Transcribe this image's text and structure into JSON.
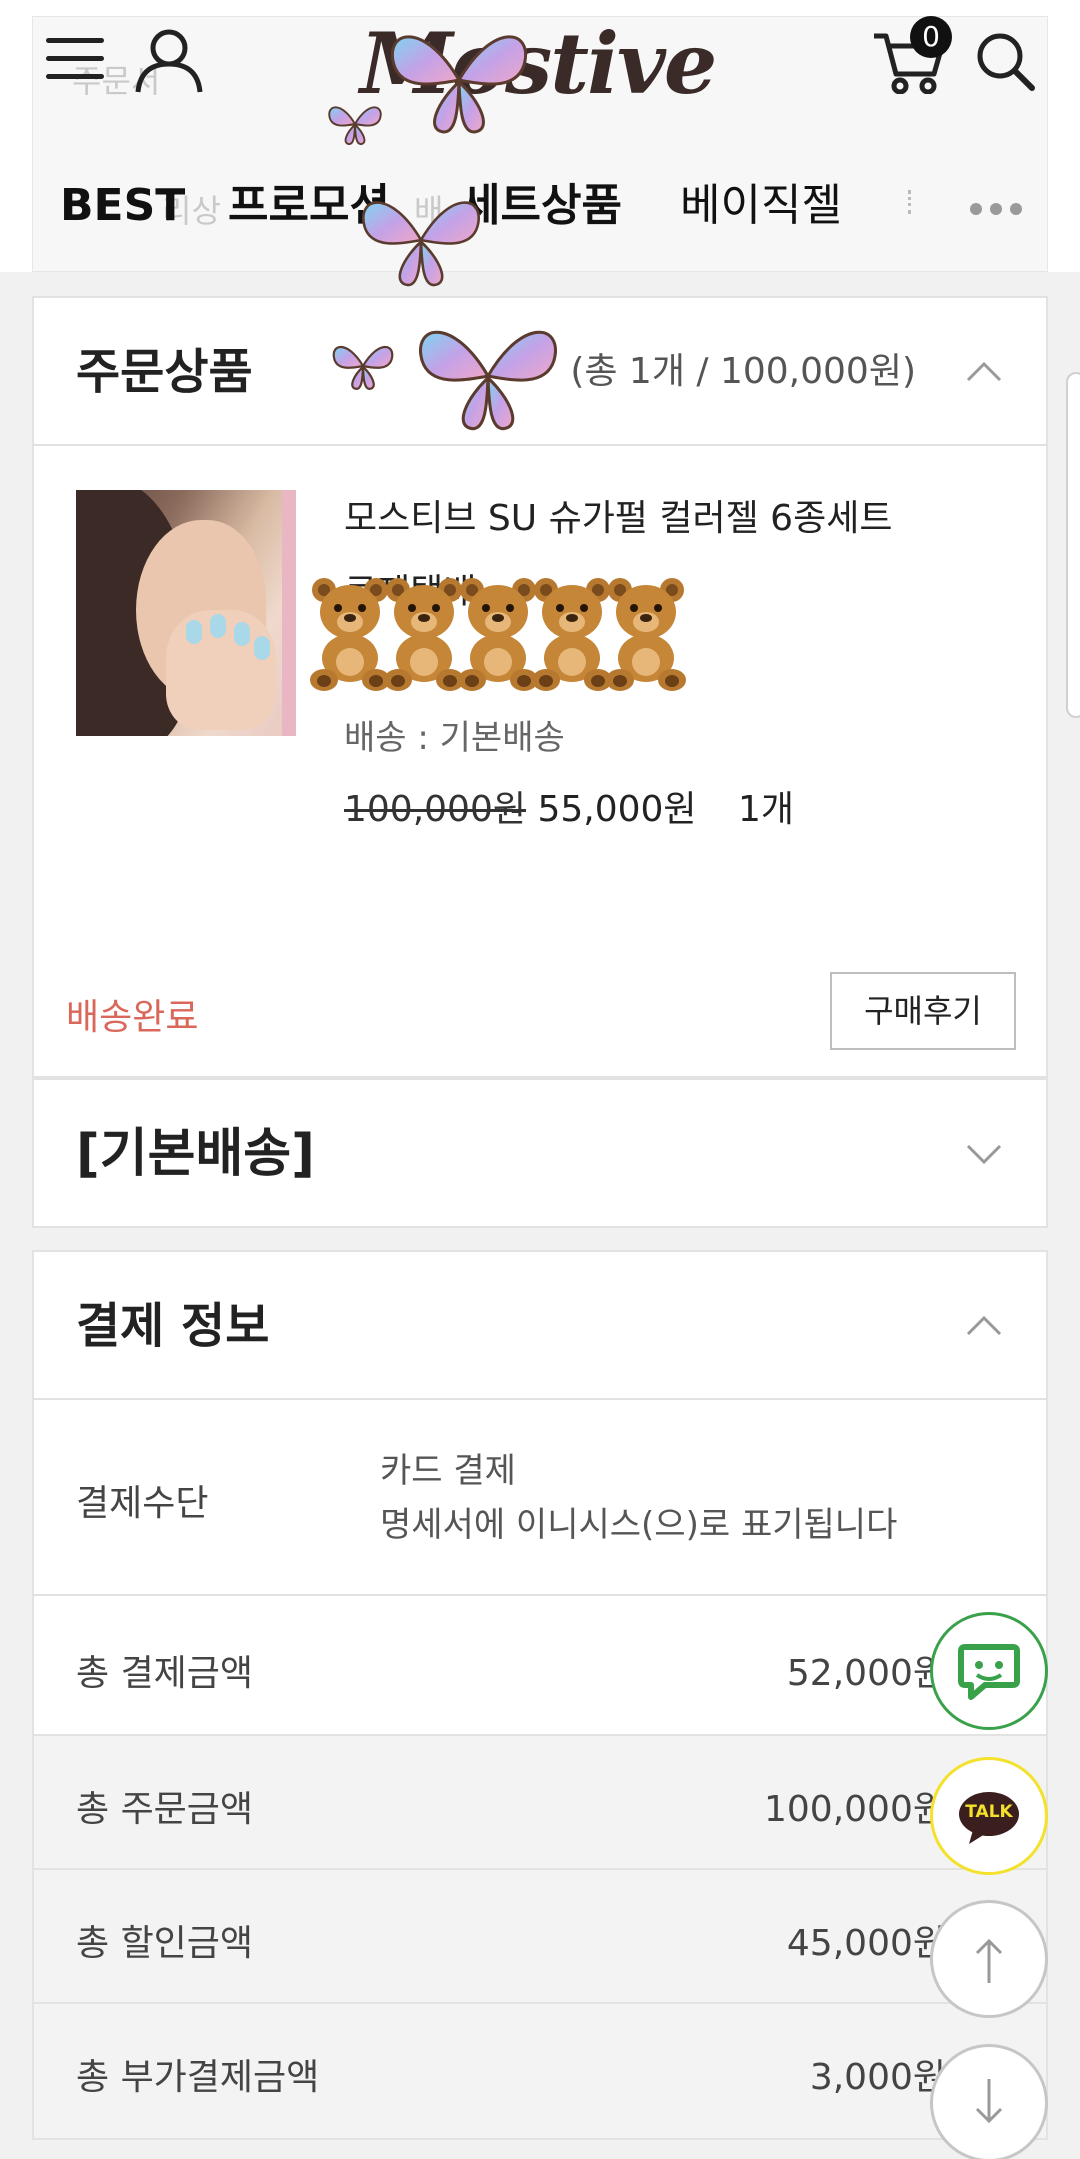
{
  "header": {
    "logo_text": "Mostive",
    "cart_count": "0",
    "ghost_text_1": "주문서",
    "ghost_text_2": "리상",
    "ghost_text_3": "배"
  },
  "nav": {
    "items": [
      "BEST",
      "프로모션",
      "세트상품",
      "베이직젤"
    ]
  },
  "order_items": {
    "title": "주문상품",
    "summary": "(총 1개 / 100,000원)",
    "product": {
      "name_line1": "모스티브 SU 슈가펄 컬러젤 6종세트",
      "name_line2": "로제택배",
      "delivery": "배송 : 기본배송",
      "price_original": "100,000원",
      "price_sale": "55,000원",
      "quantity": "1개"
    },
    "status": "배송완료",
    "review_button": "구매후기"
  },
  "shipping": {
    "title": "[기본배송]"
  },
  "payment": {
    "title": "결제 정보",
    "method_label": "결제수단",
    "method_value_1": "카드 결제",
    "method_value_2": "명세서에 이니시스(으)로 표기됩니다",
    "rows": [
      {
        "label": "총 결제금액",
        "value": "52,000원"
      },
      {
        "label": "총 주문금액",
        "value": "100,000원"
      },
      {
        "label": "총 할인금액",
        "value": "45,000원"
      },
      {
        "label": "총 부가결제금액",
        "value": "3,000원"
      }
    ]
  },
  "floating": {
    "talk_label": "TALK"
  },
  "colors": {
    "status_red": "#d9685a",
    "chat_green": "#3aa14b",
    "kakao_yellow": "#f3e12b"
  }
}
